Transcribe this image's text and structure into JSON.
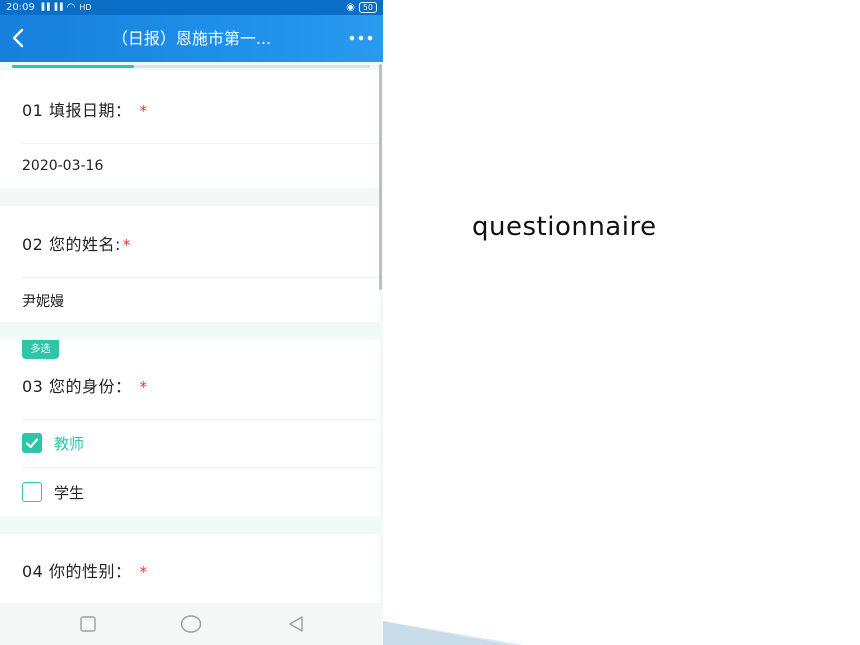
{
  "status_bar": {
    "time": "20:09",
    "signal": "▐▐ ▐▐",
    "wifi": "◠",
    "network": "HD",
    "battery": "50"
  },
  "header": {
    "title": "（日报）恩施市第一...",
    "back_icon": "chevron-left-icon",
    "more_icon": "more-dots-icon"
  },
  "progress": {
    "value": 0.34
  },
  "questions": [
    {
      "label": "01  填报日期：",
      "required_mark": "*",
      "answer": "2020-03-16"
    },
    {
      "label": "02  您的姓名:",
      "required_mark": "*",
      "answer": "尹妮嫚"
    },
    {
      "badge": "多选",
      "label": "03  您的身份：",
      "required_mark": "*",
      "options": [
        {
          "label": "教师",
          "checked": true
        },
        {
          "label": "学生",
          "checked": false
        }
      ]
    },
    {
      "label": "04  你的性别：",
      "required_mark": "*"
    }
  ],
  "caption": "questionnaire",
  "colors": {
    "accent": "#2dc6a8",
    "header_blue": "#1e90ea",
    "required_red": "#e5382f"
  }
}
